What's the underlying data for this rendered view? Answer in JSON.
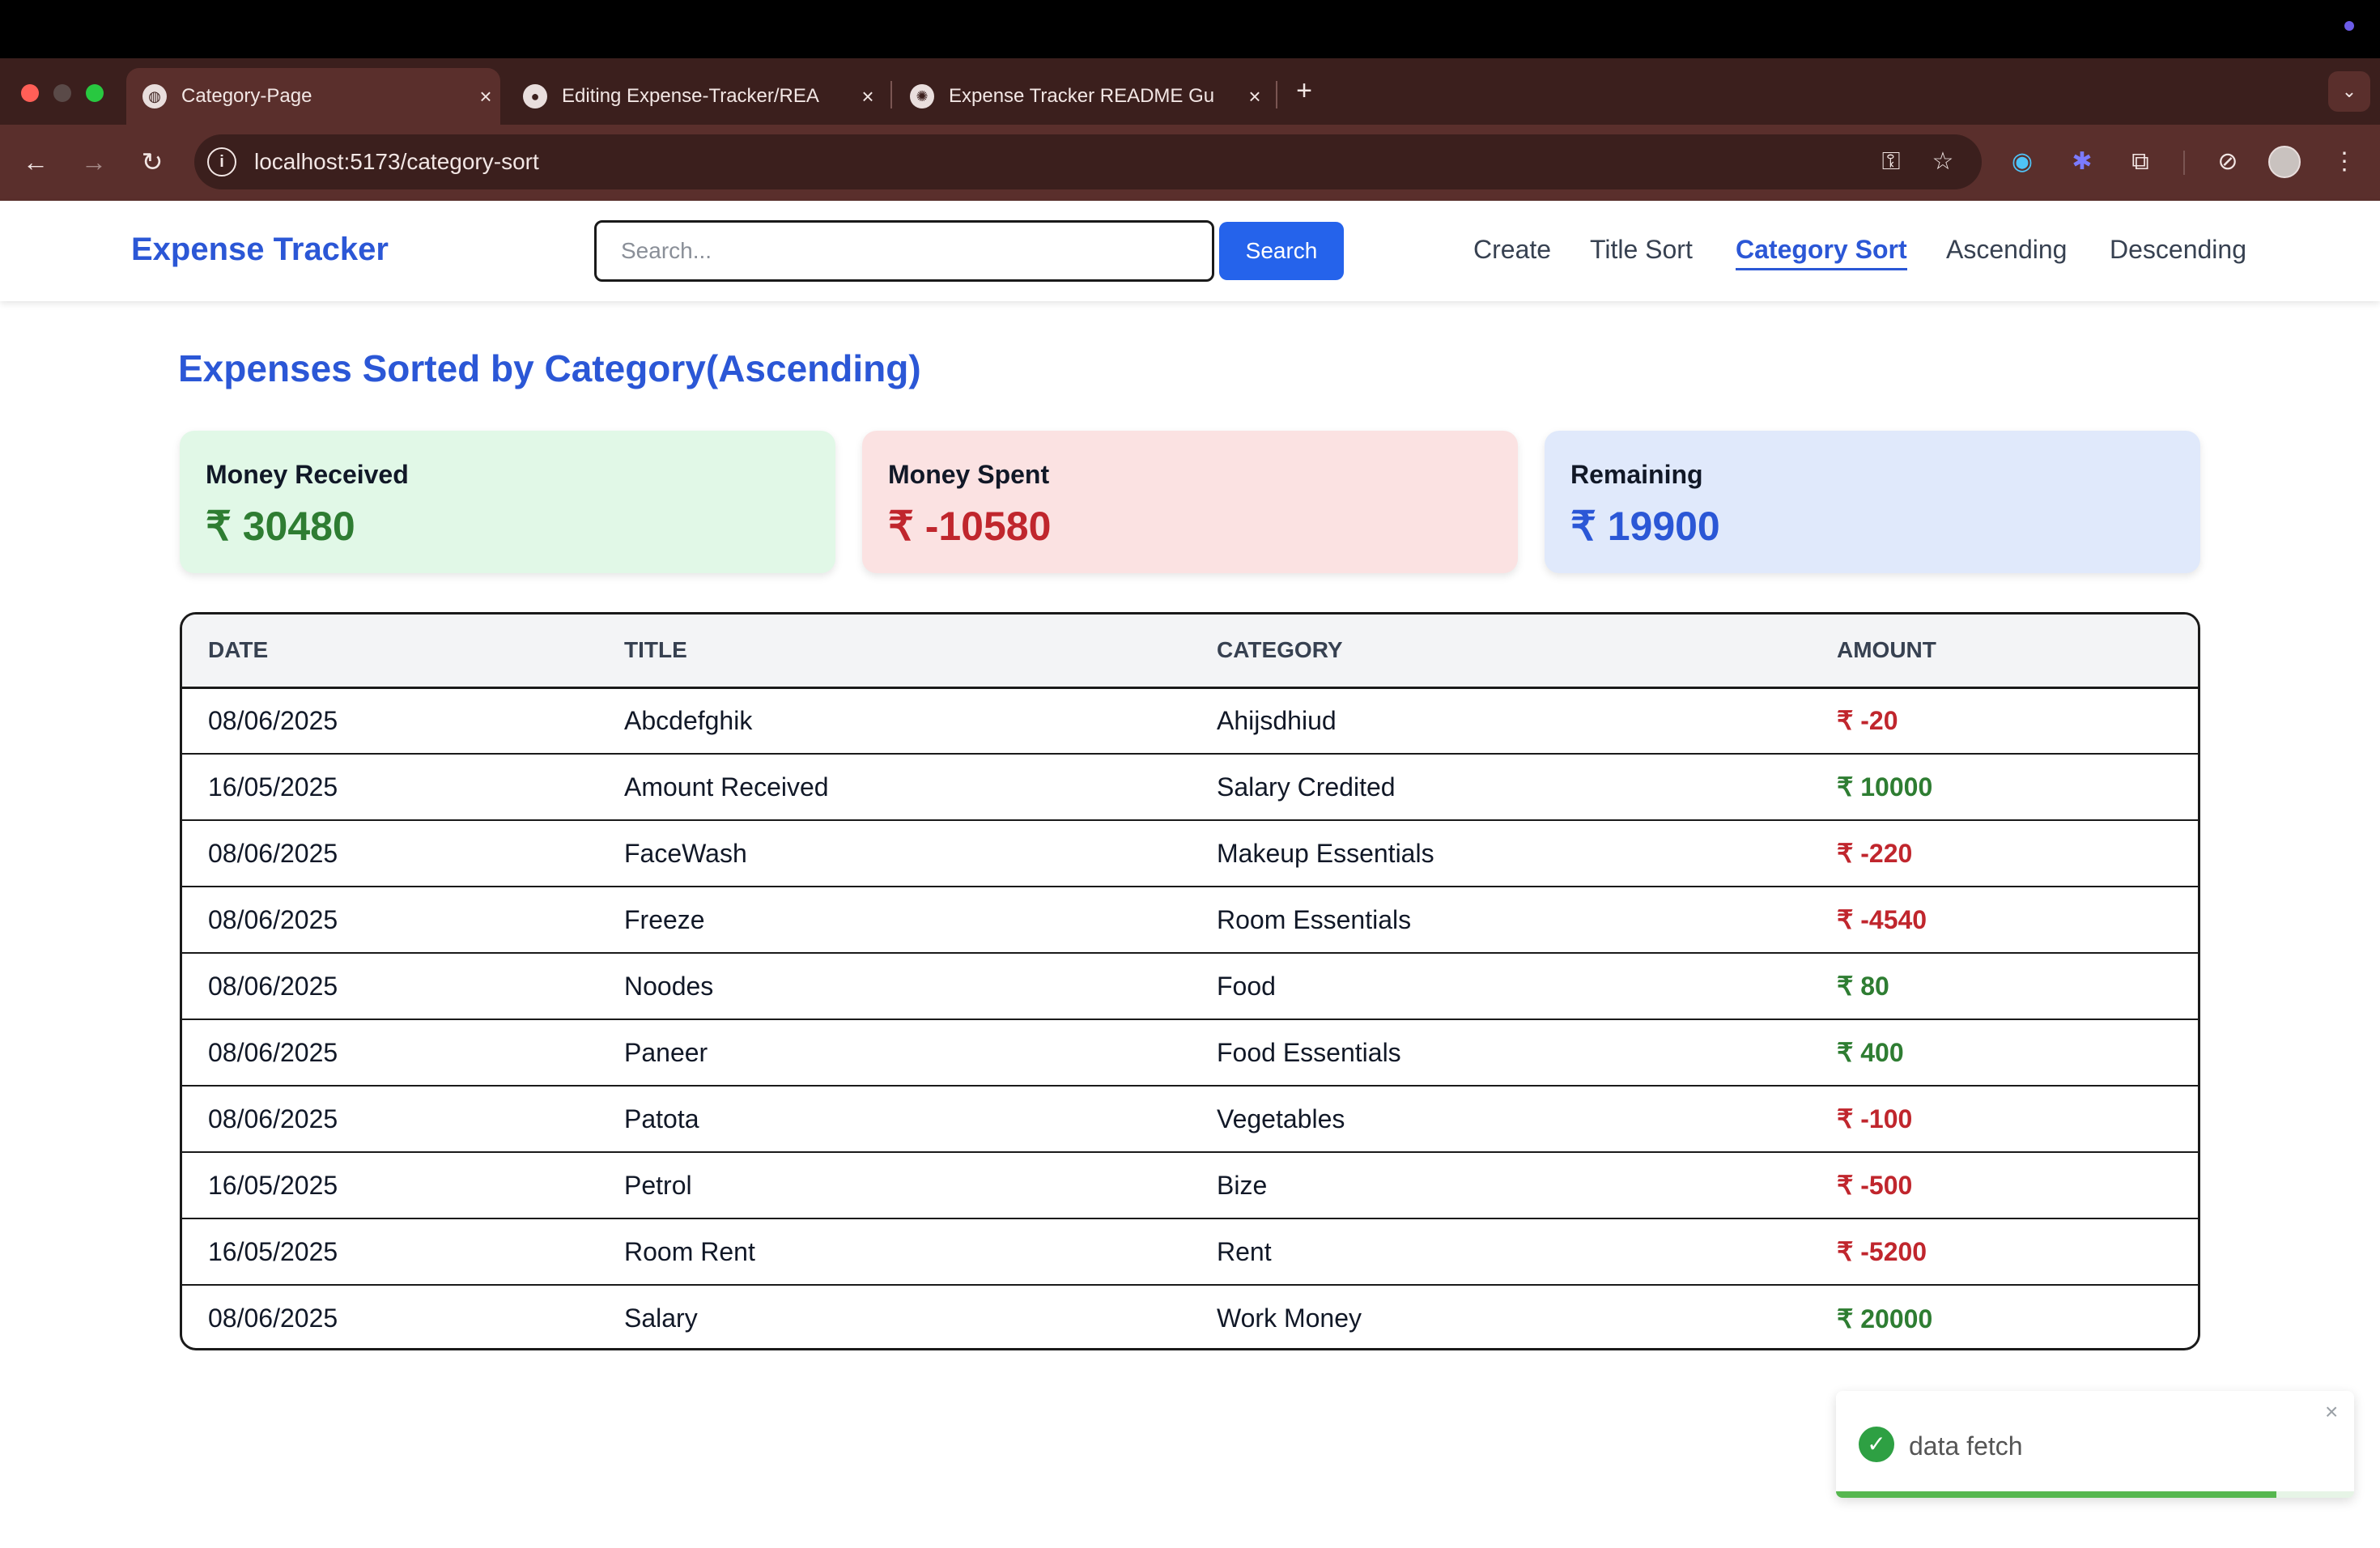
{
  "browser": {
    "tabs": [
      {
        "title": "Category-Page",
        "icon": "globe-icon",
        "active": true
      },
      {
        "title": "Editing Expense-Tracker/REA",
        "icon": "github-icon",
        "active": false
      },
      {
        "title": "Expense Tracker README Gu",
        "icon": "openai-icon",
        "active": false
      }
    ],
    "new_tab": "+",
    "tab_close": "×",
    "url": "localhost:5173/category-sort"
  },
  "header": {
    "brand": "Expense Tracker",
    "search_placeholder": "Search...",
    "search_button": "Search",
    "nav": [
      "Create",
      "Title Sort",
      "Category Sort",
      "Ascending",
      "Descending"
    ],
    "active_nav": "Category Sort"
  },
  "page": {
    "title": "Expenses Sorted by Category(Ascending)"
  },
  "summary": {
    "received": {
      "label": "Money Received",
      "value": "₹ 30480",
      "color": "#2e7d32",
      "bg": "#e1f8e7"
    },
    "spent": {
      "label": "Money Spent",
      "value": "₹ -10580",
      "color": "#c0262d",
      "bg": "#fbe2e2"
    },
    "remaining": {
      "label": "Remaining",
      "value": "₹ 19900",
      "color": "#2b57d6",
      "bg": "#e0e9fb"
    }
  },
  "table": {
    "headers": [
      "DATE",
      "TITLE",
      "CATEGORY",
      "AMOUNT"
    ],
    "rows": [
      {
        "date": "08/06/2025",
        "title": "Abcdefghik",
        "category": "Ahijsdhiud",
        "amount": "₹ -20",
        "sign": "neg"
      },
      {
        "date": "16/05/2025",
        "title": "Amount Received",
        "category": "Salary Credited",
        "amount": "₹ 10000",
        "sign": "pos"
      },
      {
        "date": "08/06/2025",
        "title": "FaceWash",
        "category": "Makeup Essentials",
        "amount": "₹ -220",
        "sign": "neg"
      },
      {
        "date": "08/06/2025",
        "title": "Freeze",
        "category": "Room Essentials",
        "amount": "₹ -4540",
        "sign": "neg"
      },
      {
        "date": "08/06/2025",
        "title": "Noodes",
        "category": "Food",
        "amount": "₹ 80",
        "sign": "pos"
      },
      {
        "date": "08/06/2025",
        "title": "Paneer",
        "category": "Food Essentials",
        "amount": "₹ 400",
        "sign": "pos"
      },
      {
        "date": "08/06/2025",
        "title": "Patota",
        "category": "Vegetables",
        "amount": "₹ -100",
        "sign": "neg"
      },
      {
        "date": "16/05/2025",
        "title": "Petrol",
        "category": "Bize",
        "amount": "₹ -500",
        "sign": "neg"
      },
      {
        "date": "16/05/2025",
        "title": "Room Rent",
        "category": "Rent",
        "amount": "₹ -5200",
        "sign": "neg"
      },
      {
        "date": "08/06/2025",
        "title": "Salary",
        "category": "Work Money",
        "amount": "₹ 20000",
        "sign": "pos"
      }
    ]
  },
  "toast": {
    "message": "data fetch",
    "close": "×",
    "progress": 0.85
  },
  "colors": {
    "accent": "#2b57d6",
    "positive": "#2e7d32",
    "negative": "#c0262d",
    "toast_success": "#2ea043"
  }
}
